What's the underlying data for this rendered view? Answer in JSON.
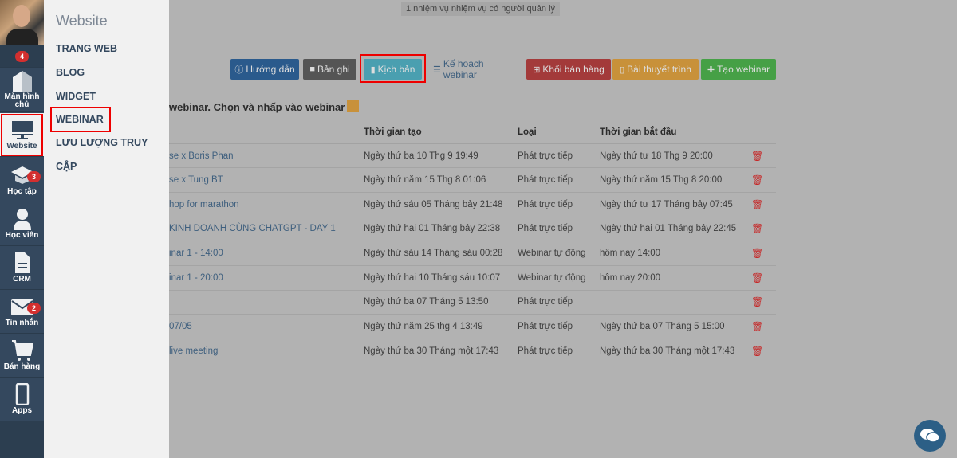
{
  "sidebar": {
    "top_badge": "4",
    "items": [
      {
        "label": "Màn hình chủ",
        "icon": "home-icon"
      },
      {
        "label": "Website",
        "icon": "monitor-icon",
        "active": true
      },
      {
        "label": "Học tập",
        "icon": "graduation-cap-icon",
        "badge": "3"
      },
      {
        "label": "Học viên",
        "icon": "user-icon"
      },
      {
        "label": "CRM",
        "icon": "document-icon"
      },
      {
        "label": "Tin nhắn",
        "icon": "mail-icon",
        "badge": "2"
      },
      {
        "label": "Bán hàng",
        "icon": "cart-icon"
      },
      {
        "label": "Apps",
        "icon": "phone-icon"
      }
    ]
  },
  "flyout": {
    "title": "Website",
    "items": [
      "TRANG WEB",
      "BLOG",
      "WIDGET",
      "WEBINAR",
      "LƯU LƯỢNG TRUY CẬP"
    ]
  },
  "notice": "1 nhiệm vụ nhiệm vụ có người quản lý",
  "toolbar": {
    "guide": "Hướng dẫn",
    "recording": "Bản ghi",
    "script": "Kịch bản",
    "plan": "Kế hoạch webinar",
    "sales_block": "Khối bán hàng",
    "presentation": "Bài thuyết trình",
    "create": "Tạo webinar"
  },
  "colors": {
    "guide": "#2a5a8c",
    "recording": "#555555",
    "script": "#4a9fb0",
    "sales_block": "#a33a3a",
    "presentation": "#c8913a",
    "create": "#46a046",
    "highlight": "#ee0000"
  },
  "hint": "webinar. Chọn và nhấp vào webinar",
  "table": {
    "headers": [
      "",
      "Thời gian tạo",
      "Loại",
      "Thời gian bắt đầu",
      ""
    ],
    "rows": [
      [
        "se x Boris Phan",
        "Ngày thứ ba 10 Thg 9 19:49",
        "Phát trực tiếp",
        "Ngày thứ tư 18 Thg 9 20:00"
      ],
      [
        "se x Tung BT",
        "Ngày thứ năm 15 Thg 8 01:06",
        "Phát trực tiếp",
        "Ngày thứ năm 15 Thg 8 20:00"
      ],
      [
        "hop for marathon",
        "Ngày thứ sáu 05 Tháng bảy 21:48",
        "Phát trực tiếp",
        "Ngày thứ tư 17 Tháng bảy 07:45"
      ],
      [
        "KINH DOANH CÙNG CHATGPT - DAY 1",
        "Ngày thứ hai 01 Tháng bảy 22:38",
        "Phát trực tiếp",
        "Ngày thứ hai 01 Tháng bảy 22:45"
      ],
      [
        "inar 1 - 14:00",
        "Ngày thứ sáu 14 Tháng sáu 00:28",
        "Webinar tự động",
        "hôm nay 14:00"
      ],
      [
        "inar 1 - 20:00",
        "Ngày thứ hai 10 Tháng sáu 10:07",
        "Webinar tự động",
        "hôm nay 20:00"
      ],
      [
        "",
        "Ngày thứ ba 07 Tháng 5 13:50",
        "Phát trực tiếp",
        ""
      ],
      [
        "07/05",
        "Ngày thứ năm 25 thg 4 13:49",
        "Phát trực tiếp",
        "Ngày thứ ba 07 Tháng 5 15:00"
      ],
      [
        "live meeting",
        "Ngày thứ ba 30 Tháng một 17:43",
        "Phát trực tiếp",
        "Ngày thứ ba 30 Tháng một 17:43"
      ]
    ]
  }
}
